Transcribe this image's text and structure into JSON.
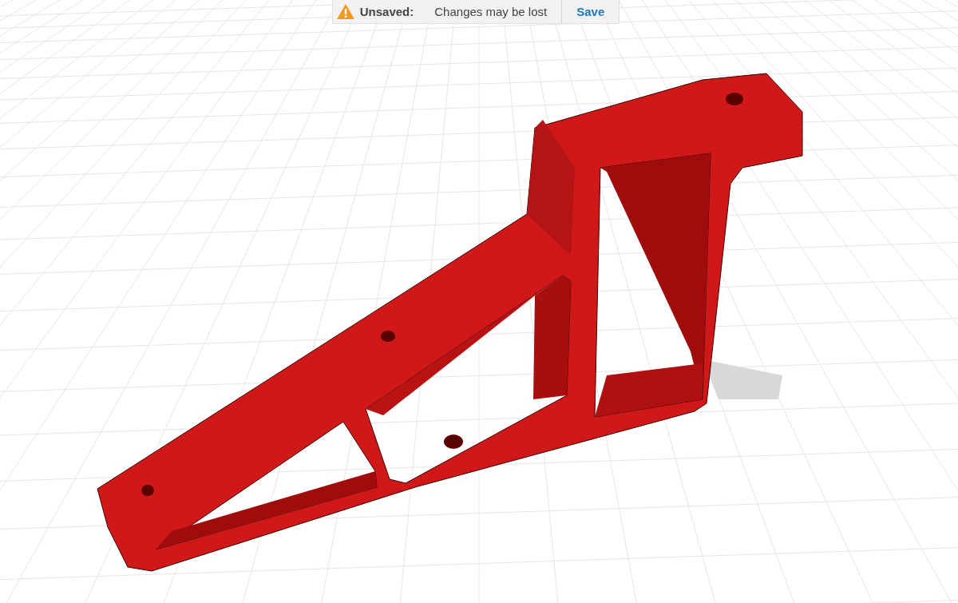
{
  "notification": {
    "label": "Unsaved:",
    "message": "Changes may be lost",
    "action": "Save"
  }
}
